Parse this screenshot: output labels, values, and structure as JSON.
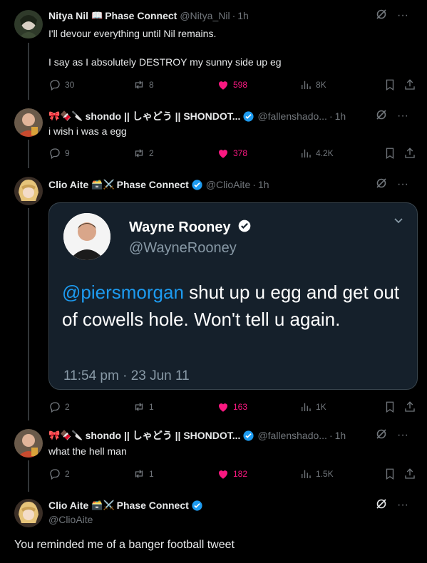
{
  "tweets": [
    {
      "name": "Nitya Nil",
      "badge_emoji": "📖",
      "affiliation": "Phase Connect",
      "handle": "@Nitya_Nil",
      "time": "1h",
      "text_line1": "I'll devour everything until Nil remains.",
      "text_line2": "I say as I absolutely DESTROY my sunny side up eg",
      "replies": "30",
      "reposts": "8",
      "likes": "598",
      "views": "8K"
    },
    {
      "name_emojis": "🎀🍫🔪",
      "name": "shondo || しゃどう || SHONDOT...",
      "handle": "@fallenshado...",
      "time": "1h",
      "text": "i wish i was a egg",
      "replies": "9",
      "reposts": "2",
      "likes": "378",
      "views": "4.2K"
    },
    {
      "name": "Clio Aite",
      "badge_emoji": "🗃️⚔️",
      "affiliation": "Phase Connect",
      "handle": "@ClioAite",
      "time": "1h",
      "replies": "2",
      "reposts": "1",
      "likes": "163",
      "views": "1K",
      "embed": {
        "name": "Wayne Rooney",
        "handle": "@WayneRooney",
        "mention": "@piersmorgan",
        "text_rest": " shut up u egg and get out of cowells hole. Won't tell u again.",
        "timestamp": "11:54 pm · 23 Jun 11"
      }
    },
    {
      "name_emojis": "🎀🍫🔪",
      "name": "shondo || しゃどう || SHONDOT...",
      "handle": "@fallenshado...",
      "time": "1h",
      "text": "what the hell man",
      "replies": "2",
      "reposts": "1",
      "likes": "182",
      "views": "1.5K"
    },
    {
      "name": "Clio Aite",
      "badge_emoji": "🗃️⚔️",
      "affiliation": "Phase Connect",
      "handle": "@ClioAite",
      "text": "You reminded me of a banger football tweet"
    }
  ],
  "separator": "·",
  "colors": {
    "like": "#f91880",
    "verified": "#1d9bf0",
    "muted": "#71767b",
    "link": "#1d9bf0"
  }
}
